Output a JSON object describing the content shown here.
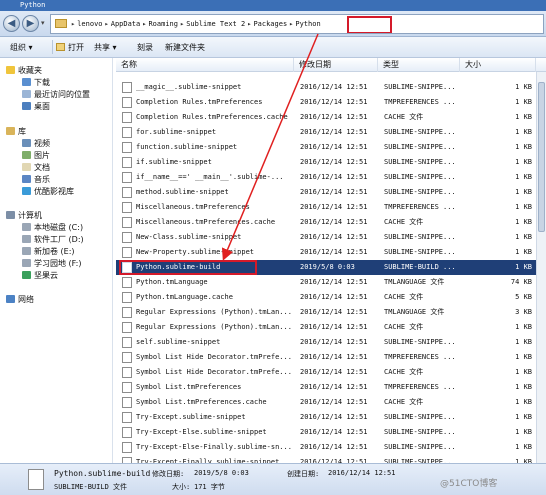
{
  "window": {
    "title": "Python"
  },
  "address": {
    "crumbs": [
      "lenovo",
      "AppData",
      "Roaming",
      "Sublime Text 2",
      "Packages",
      "Python"
    ]
  },
  "toolbar": {
    "organize": "组织 ▾",
    "open": "打开",
    "share": "共享 ▾",
    "burn": "刻录",
    "new_folder": "新建文件夹"
  },
  "sidebar": {
    "favorites": "收藏夹",
    "downloads": "下载",
    "recent": "最近访问的位置",
    "desktop": "桌面",
    "libraries": "库",
    "videos": "视频",
    "pictures": "图片",
    "documents": "文档",
    "music": "音乐",
    "youku": "优酷影视库",
    "computer": "计算机",
    "drive_c": "本地磁盘 (C:)",
    "drive_d": "软件工厂 (D:)",
    "drive_e": "新加卷 (E:)",
    "drive_f": "学习园地 (F:)",
    "jianguoyun": "坚果云",
    "network": "网络"
  },
  "columns": {
    "name": "名称",
    "date": "修改日期",
    "type": "类型",
    "size": "大小"
  },
  "files": [
    {
      "name": "__magic__.sublime-snippet",
      "date": "2016/12/14 12:51",
      "type": "SUBLIME-SNIPPE...",
      "size": "1 KB"
    },
    {
      "name": "Completion Rules.tmPreferences",
      "date": "2016/12/14 12:51",
      "type": "TMPREFERENCES ...",
      "size": "1 KB"
    },
    {
      "name": "Completion Rules.tmPreferences.cache",
      "date": "2016/12/14 12:51",
      "type": "CACHE 文件",
      "size": "1 KB"
    },
    {
      "name": "for.sublime-snippet",
      "date": "2016/12/14 12:51",
      "type": "SUBLIME-SNIPPE...",
      "size": "1 KB"
    },
    {
      "name": "function.sublime-snippet",
      "date": "2016/12/14 12:51",
      "type": "SUBLIME-SNIPPE...",
      "size": "1 KB"
    },
    {
      "name": "if.sublime-snippet",
      "date": "2016/12/14 12:51",
      "type": "SUBLIME-SNIPPE...",
      "size": "1 KB"
    },
    {
      "name": "if__name__==' __main__'.sublime-...",
      "date": "2016/12/14 12:51",
      "type": "SUBLIME-SNIPPE...",
      "size": "1 KB"
    },
    {
      "name": "method.sublime-snippet",
      "date": "2016/12/14 12:51",
      "type": "SUBLIME-SNIPPE...",
      "size": "1 KB"
    },
    {
      "name": "Miscellaneous.tmPreferences",
      "date": "2016/12/14 12:51",
      "type": "TMPREFERENCES ...",
      "size": "1 KB"
    },
    {
      "name": "Miscellaneous.tmPreferences.cache",
      "date": "2016/12/14 12:51",
      "type": "CACHE 文件",
      "size": "1 KB"
    },
    {
      "name": "New-Class.sublime-snippet",
      "date": "2016/12/14 12:51",
      "type": "SUBLIME-SNIPPE...",
      "size": "1 KB"
    },
    {
      "name": "New-Property.sublime-snippet",
      "date": "2016/12/14 12:51",
      "type": "SUBLIME-SNIPPE...",
      "size": "1 KB"
    },
    {
      "name": "Python.sublime-build",
      "date": "2019/5/8 0:03",
      "type": "SUBLIME-BUILD ...",
      "size": "1 KB"
    },
    {
      "name": "Python.tmLanguage",
      "date": "2016/12/14 12:51",
      "type": "TMLANGUAGE 文件",
      "size": "74 KB"
    },
    {
      "name": "Python.tmLanguage.cache",
      "date": "2016/12/14 12:51",
      "type": "CACHE 文件",
      "size": "5 KB"
    },
    {
      "name": "Regular Expressions (Python).tmLan...",
      "date": "2016/12/14 12:51",
      "type": "TMLANGUAGE 文件",
      "size": "3 KB"
    },
    {
      "name": "Regular Expressions (Python).tmLan...",
      "date": "2016/12/14 12:51",
      "type": "CACHE 文件",
      "size": "1 KB"
    },
    {
      "name": "self.sublime-snippet",
      "date": "2016/12/14 12:51",
      "type": "SUBLIME-SNIPPE...",
      "size": "1 KB"
    },
    {
      "name": "Symbol List Hide Decorator.tmPrefe...",
      "date": "2016/12/14 12:51",
      "type": "TMPREFERENCES ...",
      "size": "1 KB"
    },
    {
      "name": "Symbol List Hide Decorator.tmPrefe...",
      "date": "2016/12/14 12:51",
      "type": "CACHE 文件",
      "size": "1 KB"
    },
    {
      "name": "Symbol List.tmPreferences",
      "date": "2016/12/14 12:51",
      "type": "TMPREFERENCES ...",
      "size": "1 KB"
    },
    {
      "name": "Symbol List.tmPreferences.cache",
      "date": "2016/12/14 12:51",
      "type": "CACHE 文件",
      "size": "1 KB"
    },
    {
      "name": "Try-Except.sublime-snippet",
      "date": "2016/12/14 12:51",
      "type": "SUBLIME-SNIPPE...",
      "size": "1 KB"
    },
    {
      "name": "Try-Except-Else.sublime-snippet",
      "date": "2016/12/14 12:51",
      "type": "SUBLIME-SNIPPE...",
      "size": "1 KB"
    },
    {
      "name": "Try-Except-Else-Finally.sublime-sn...",
      "date": "2016/12/14 12:51",
      "type": "SUBLIME-SNIPPE...",
      "size": "1 KB"
    },
    {
      "name": "Try-Except-Finally.sublime-snippet",
      "date": "2016/12/14 12:51",
      "type": "SUBLIME-SNIPPE...",
      "size": "1 KB"
    }
  ],
  "status": {
    "filename": "Python.sublime-build",
    "modified_label": "修改日期:",
    "modified_value": "2019/5/8 0:03",
    "created_label": "创建日期:",
    "created_value": "2016/12/14 12:51",
    "type": "SUBLIME-BUILD 文件",
    "size_label": "大小:",
    "size_value": "171 字节",
    "watermark": "@51CTO博客"
  },
  "colors": {
    "selection": "#1f3f77",
    "highlight_box": "#d41a2a",
    "arrow": "#e02020"
  }
}
